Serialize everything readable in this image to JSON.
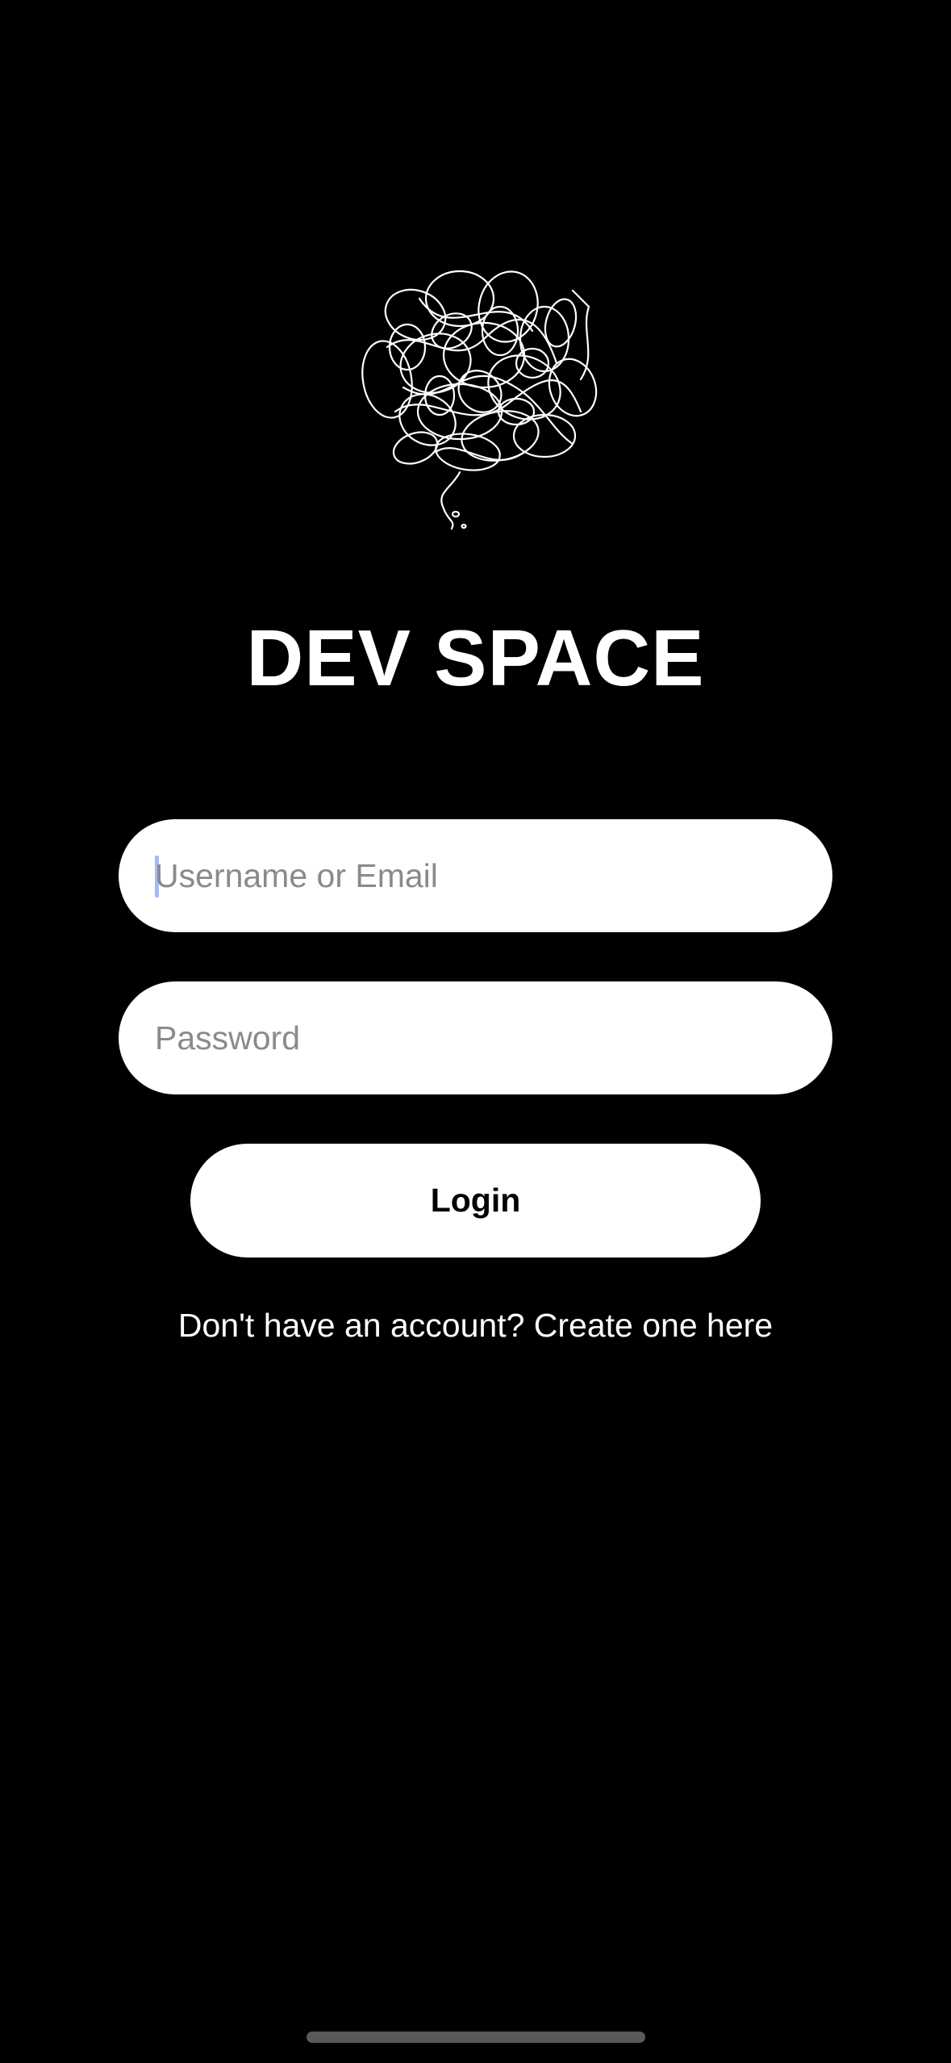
{
  "app": {
    "title": "DEV SPACE",
    "logo_icon": "scribble-cloud-icon"
  },
  "form": {
    "username": {
      "value": "",
      "placeholder": "Username or Email"
    },
    "password": {
      "value": "",
      "placeholder": "Password"
    },
    "login_label": "Login",
    "signup_text": "Don't have an account? Create one here"
  },
  "colors": {
    "background": "#000000",
    "foreground": "#ffffff",
    "placeholder": "#8a8a8e",
    "caret": "#a7b9f5"
  }
}
